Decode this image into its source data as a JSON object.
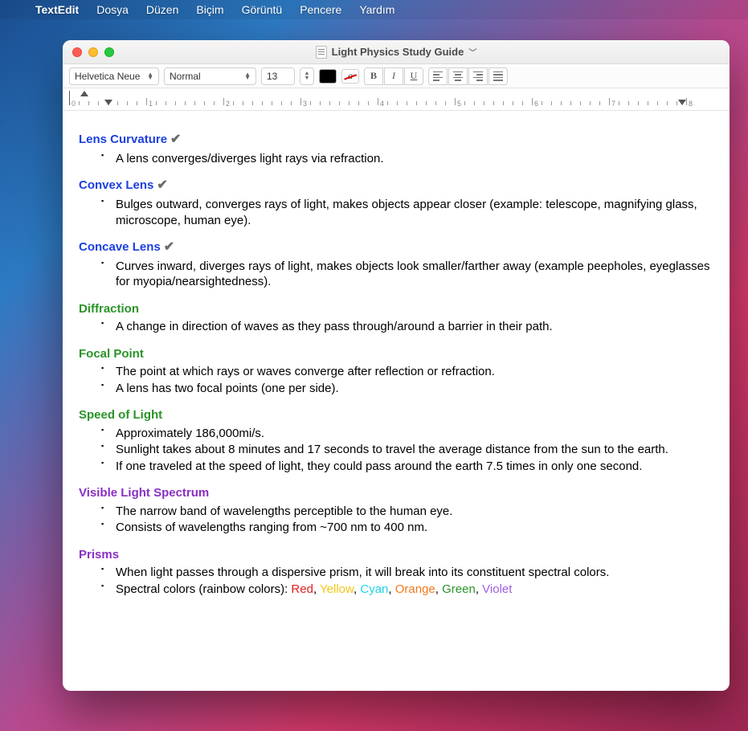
{
  "menubar": {
    "app": "TextEdit",
    "items": [
      "Dosya",
      "Düzen",
      "Biçim",
      "Görüntü",
      "Pencere",
      "Yardım"
    ]
  },
  "window": {
    "title": "Light Physics Study Guide"
  },
  "toolbar": {
    "font": "Helvetica Neue",
    "style": "Normal",
    "size": "13",
    "bold": "B",
    "italic": "I",
    "underline": "U"
  },
  "ruler": {
    "numbers": [
      "0",
      "1",
      "2",
      "3",
      "4",
      "5",
      "6",
      "7",
      "8"
    ]
  },
  "sections": [
    {
      "heading": "Lens Curvature",
      "color": "blue",
      "check": true,
      "bullets": [
        "A lens converges/diverges light rays via refraction."
      ]
    },
    {
      "heading": "Convex Lens",
      "color": "blue",
      "check": true,
      "bullets": [
        "Bulges outward, converges rays of light, makes objects appear closer (example: telescope, magnifying glass, microscope, human eye)."
      ]
    },
    {
      "heading": "Concave Lens",
      "color": "blue",
      "check": true,
      "bullets": [
        "Curves inward, diverges rays of light, makes objects look smaller/farther away (example peepholes, eyeglasses for myopia/nearsightedness)."
      ]
    },
    {
      "heading": "Diffraction",
      "color": "green",
      "check": false,
      "bullets": [
        "A change in direction of waves as they pass through/around a barrier in their path."
      ]
    },
    {
      "heading": "Focal Point",
      "color": "green",
      "check": false,
      "bullets": [
        "The point at which rays or waves converge after reflection or refraction.",
        "A lens has two focal points (one per side)."
      ]
    },
    {
      "heading": "Speed of Light",
      "color": "green",
      "check": false,
      "bullets": [
        "Approximately 186,000mi/s.",
        "Sunlight takes about 8 minutes and 17 seconds to travel the average distance from the sun to the earth.",
        "If one traveled at the speed of light, they could pass around the earth 7.5 times in only one second."
      ]
    },
    {
      "heading": "Visible Light Spectrum",
      "color": "purple",
      "check": false,
      "bullets": [
        "The narrow band of wavelengths perceptible to the human eye.",
        "Consists of wavelengths ranging from ~700 nm to 400 nm."
      ]
    },
    {
      "heading": "Prisms",
      "color": "purple",
      "check": false,
      "bullets": [
        "When light passes through a dispersive prism, it will break into its constituent spectral colors."
      ],
      "spectral": {
        "prefix": "Spectral colors (rainbow colors): ",
        "colors": [
          {
            "label": "Red",
            "class": "red"
          },
          {
            "label": "Yellow",
            "class": "yellow"
          },
          {
            "label": "Cyan",
            "class": "cyan"
          },
          {
            "label": "Orange",
            "class": "orange"
          },
          {
            "label": "Green",
            "class": "greenc"
          },
          {
            "label": "Violet",
            "class": "violet"
          }
        ]
      }
    }
  ]
}
